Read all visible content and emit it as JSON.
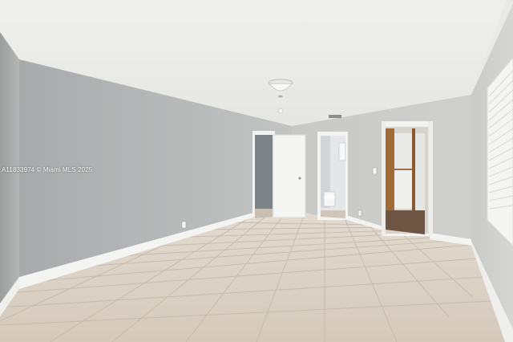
{
  "photo": {
    "watermark_text": "A11833974 © Miami MLS 2025"
  }
}
